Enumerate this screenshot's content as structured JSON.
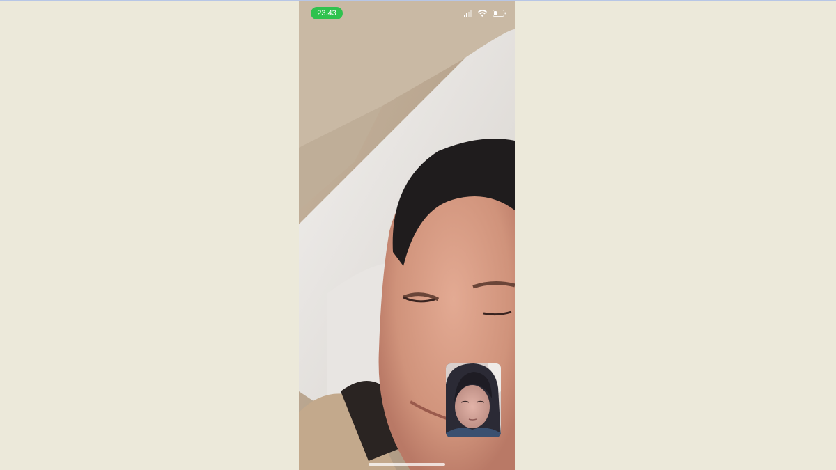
{
  "status_bar": {
    "time": "23.43",
    "time_pill_color": "#2fc24e",
    "icons": [
      "cellular-signal-icon",
      "wifi-icon",
      "battery-icon"
    ]
  },
  "call": {
    "remote_video": "video-feed",
    "self_view": "self-preview-feed"
  }
}
